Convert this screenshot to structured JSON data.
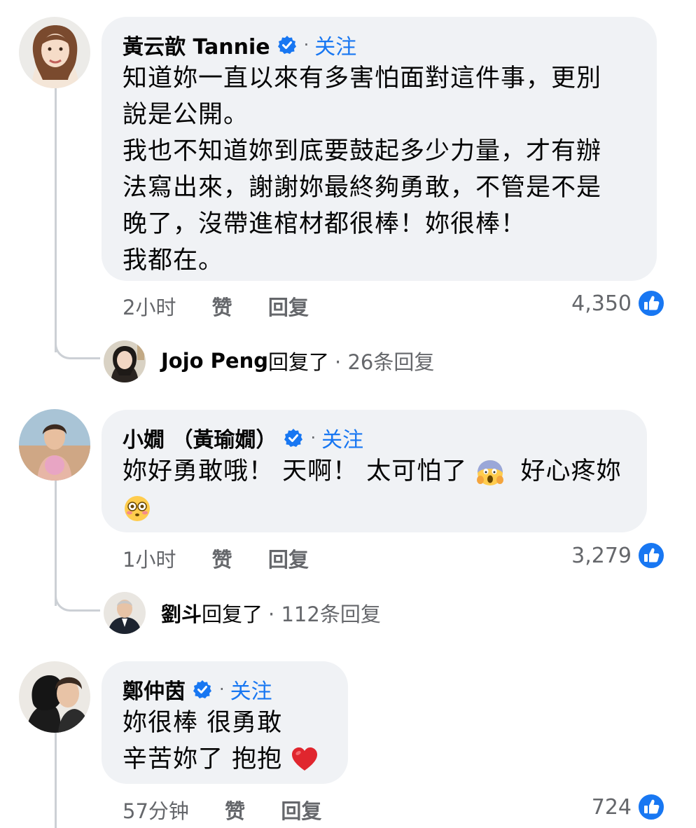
{
  "comments": [
    {
      "author": "黃云歆 Tannie",
      "follow": "关注",
      "dot": "·",
      "lines": [
        "知道妳一直以來有多害怕面對這件事，更別",
        "說是公開。",
        "我也不知道妳到底要鼓起多少力量，才有辦",
        "法寫出來，謝謝妳最終夠勇敢，不管是不是",
        "晚了，沒帶進棺材都很棒！妳很棒！",
        "我都在。"
      ],
      "time": "2小时",
      "like_label": "赞",
      "reply_label": "回复",
      "reaction_count": "4,350",
      "reply_thread": {
        "name": "Jojo Peng",
        "replied": "回复了",
        "count": "· 26条回复"
      }
    },
    {
      "author": "小嫺 （黃瑜嫺）",
      "follow": "关注",
      "dot": "·",
      "lines": [
        "妳好勇敢哦！ 天啊！ 太可怕了",
        "好心疼妳"
      ],
      "emojis": [
        "face-screaming-in-fear",
        "flushed-face"
      ],
      "time": "1小时",
      "like_label": "赞",
      "reply_label": "回复",
      "reaction_count": "3,279",
      "reply_thread": {
        "name": "劉斗",
        "replied": "回复了",
        "count": "· 112条回复"
      }
    },
    {
      "author": "鄭仲茵",
      "follow": "关注",
      "dot": "·",
      "lines": [
        "妳很棒 很勇敢",
        "辛苦妳了 抱抱"
      ],
      "emojis": [
        "red-heart"
      ],
      "time": "57分钟",
      "like_label": "赞",
      "reply_label": "回复",
      "reaction_count": "724"
    }
  ],
  "colors": {
    "bubble": "#f0f2f5",
    "link": "#1877f2",
    "muted": "#65676b",
    "verified": "#1877f2",
    "like_badge": "#1877f2"
  },
  "icons": {
    "verified": "verified-badge-icon",
    "like": "thumbs-up-icon"
  }
}
